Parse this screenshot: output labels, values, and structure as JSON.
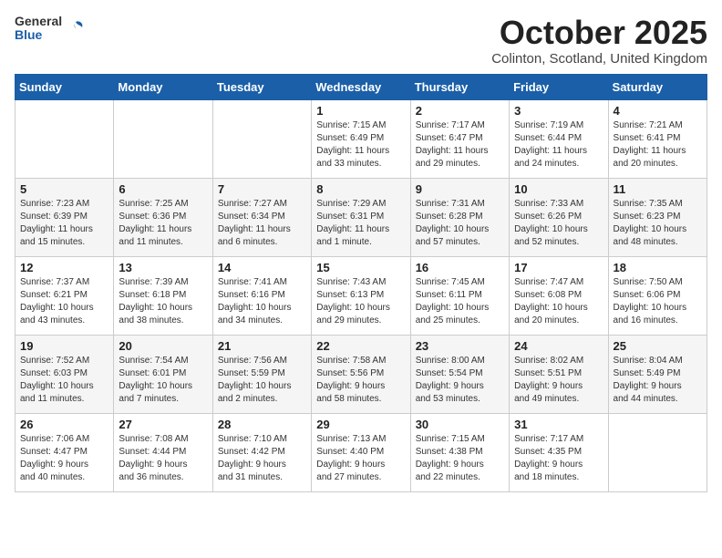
{
  "header": {
    "logo_general": "General",
    "logo_blue": "Blue",
    "month": "October 2025",
    "location": "Colinton, Scotland, United Kingdom"
  },
  "weekdays": [
    "Sunday",
    "Monday",
    "Tuesday",
    "Wednesday",
    "Thursday",
    "Friday",
    "Saturday"
  ],
  "weeks": [
    [
      {
        "day": "",
        "info": ""
      },
      {
        "day": "",
        "info": ""
      },
      {
        "day": "",
        "info": ""
      },
      {
        "day": "1",
        "info": "Sunrise: 7:15 AM\nSunset: 6:49 PM\nDaylight: 11 hours\nand 33 minutes."
      },
      {
        "day": "2",
        "info": "Sunrise: 7:17 AM\nSunset: 6:47 PM\nDaylight: 11 hours\nand 29 minutes."
      },
      {
        "day": "3",
        "info": "Sunrise: 7:19 AM\nSunset: 6:44 PM\nDaylight: 11 hours\nand 24 minutes."
      },
      {
        "day": "4",
        "info": "Sunrise: 7:21 AM\nSunset: 6:41 PM\nDaylight: 11 hours\nand 20 minutes."
      }
    ],
    [
      {
        "day": "5",
        "info": "Sunrise: 7:23 AM\nSunset: 6:39 PM\nDaylight: 11 hours\nand 15 minutes."
      },
      {
        "day": "6",
        "info": "Sunrise: 7:25 AM\nSunset: 6:36 PM\nDaylight: 11 hours\nand 11 minutes."
      },
      {
        "day": "7",
        "info": "Sunrise: 7:27 AM\nSunset: 6:34 PM\nDaylight: 11 hours\nand 6 minutes."
      },
      {
        "day": "8",
        "info": "Sunrise: 7:29 AM\nSunset: 6:31 PM\nDaylight: 11 hours\nand 1 minute."
      },
      {
        "day": "9",
        "info": "Sunrise: 7:31 AM\nSunset: 6:28 PM\nDaylight: 10 hours\nand 57 minutes."
      },
      {
        "day": "10",
        "info": "Sunrise: 7:33 AM\nSunset: 6:26 PM\nDaylight: 10 hours\nand 52 minutes."
      },
      {
        "day": "11",
        "info": "Sunrise: 7:35 AM\nSunset: 6:23 PM\nDaylight: 10 hours\nand 48 minutes."
      }
    ],
    [
      {
        "day": "12",
        "info": "Sunrise: 7:37 AM\nSunset: 6:21 PM\nDaylight: 10 hours\nand 43 minutes."
      },
      {
        "day": "13",
        "info": "Sunrise: 7:39 AM\nSunset: 6:18 PM\nDaylight: 10 hours\nand 38 minutes."
      },
      {
        "day": "14",
        "info": "Sunrise: 7:41 AM\nSunset: 6:16 PM\nDaylight: 10 hours\nand 34 minutes."
      },
      {
        "day": "15",
        "info": "Sunrise: 7:43 AM\nSunset: 6:13 PM\nDaylight: 10 hours\nand 29 minutes."
      },
      {
        "day": "16",
        "info": "Sunrise: 7:45 AM\nSunset: 6:11 PM\nDaylight: 10 hours\nand 25 minutes."
      },
      {
        "day": "17",
        "info": "Sunrise: 7:47 AM\nSunset: 6:08 PM\nDaylight: 10 hours\nand 20 minutes."
      },
      {
        "day": "18",
        "info": "Sunrise: 7:50 AM\nSunset: 6:06 PM\nDaylight: 10 hours\nand 16 minutes."
      }
    ],
    [
      {
        "day": "19",
        "info": "Sunrise: 7:52 AM\nSunset: 6:03 PM\nDaylight: 10 hours\nand 11 minutes."
      },
      {
        "day": "20",
        "info": "Sunrise: 7:54 AM\nSunset: 6:01 PM\nDaylight: 10 hours\nand 7 minutes."
      },
      {
        "day": "21",
        "info": "Sunrise: 7:56 AM\nSunset: 5:59 PM\nDaylight: 10 hours\nand 2 minutes."
      },
      {
        "day": "22",
        "info": "Sunrise: 7:58 AM\nSunset: 5:56 PM\nDaylight: 9 hours\nand 58 minutes."
      },
      {
        "day": "23",
        "info": "Sunrise: 8:00 AM\nSunset: 5:54 PM\nDaylight: 9 hours\nand 53 minutes."
      },
      {
        "day": "24",
        "info": "Sunrise: 8:02 AM\nSunset: 5:51 PM\nDaylight: 9 hours\nand 49 minutes."
      },
      {
        "day": "25",
        "info": "Sunrise: 8:04 AM\nSunset: 5:49 PM\nDaylight: 9 hours\nand 44 minutes."
      }
    ],
    [
      {
        "day": "26",
        "info": "Sunrise: 7:06 AM\nSunset: 4:47 PM\nDaylight: 9 hours\nand 40 minutes."
      },
      {
        "day": "27",
        "info": "Sunrise: 7:08 AM\nSunset: 4:44 PM\nDaylight: 9 hours\nand 36 minutes."
      },
      {
        "day": "28",
        "info": "Sunrise: 7:10 AM\nSunset: 4:42 PM\nDaylight: 9 hours\nand 31 minutes."
      },
      {
        "day": "29",
        "info": "Sunrise: 7:13 AM\nSunset: 4:40 PM\nDaylight: 9 hours\nand 27 minutes."
      },
      {
        "day": "30",
        "info": "Sunrise: 7:15 AM\nSunset: 4:38 PM\nDaylight: 9 hours\nand 22 minutes."
      },
      {
        "day": "31",
        "info": "Sunrise: 7:17 AM\nSunset: 4:35 PM\nDaylight: 9 hours\nand 18 minutes."
      },
      {
        "day": "",
        "info": ""
      }
    ]
  ]
}
